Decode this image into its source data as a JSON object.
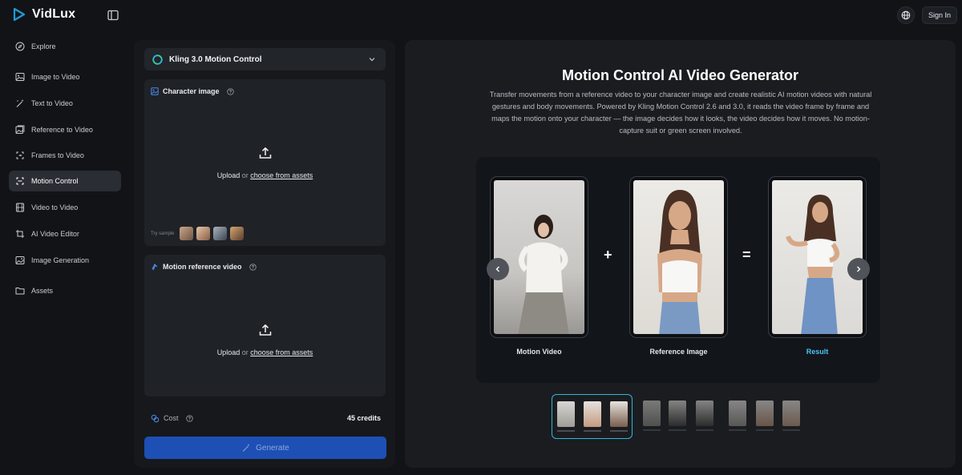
{
  "app": {
    "name": "VidLux",
    "brand_color": "#1e9bd7",
    "accent_color": "#31b7d8"
  },
  "header": {
    "sign_in_label": "Sign In",
    "language_icon": "globe-icon",
    "sidebar_toggle_icon": "sidebar-toggle-icon"
  },
  "sidebar": {
    "items": [
      {
        "label": "Explore",
        "icon": "compass-icon"
      },
      {
        "label": "Image to Video",
        "icon": "image-icon"
      },
      {
        "label": "Text to Video",
        "icon": "magic-wand-icon"
      },
      {
        "label": "Reference to Video",
        "icon": "image-stack-icon"
      },
      {
        "label": "Frames to Video",
        "icon": "frames-icon"
      },
      {
        "label": "Motion Control",
        "icon": "motion-icon",
        "active": true
      },
      {
        "label": "Video to Video",
        "icon": "film-icon"
      },
      {
        "label": "AI Video Editor",
        "icon": "crop-icon"
      },
      {
        "label": "Image Generation",
        "icon": "image-sparkle-icon"
      },
      {
        "label": "Assets",
        "icon": "folder-icon"
      }
    ]
  },
  "form": {
    "model": {
      "selected": "Kling 3.0 Motion Control"
    },
    "character": {
      "title": "Character image",
      "upload": "Upload",
      "or": "or",
      "choose": "choose from assets",
      "try_label": "Try sample"
    },
    "motion": {
      "title": "Motion reference video",
      "upload": "Upload",
      "or": "or",
      "choose": "choose from assets"
    },
    "cost": {
      "label": "Cost",
      "value": "45 credits"
    },
    "generate_label": "Generate"
  },
  "hero": {
    "title": "Motion Control AI Video Generator",
    "description": "Transfer movements from a reference video to your character image and create realistic AI motion videos with natural gestures and body movements. Powered by Kling Motion Control 2.6 and 3.0, it reads the video frame by frame and maps the motion onto your character — the image decides how it looks, the video decides how it moves. No motion-capture suit or green screen involved.",
    "demo": {
      "labels": [
        "Motion Video",
        "Reference Image",
        "Result"
      ],
      "plus": "+",
      "equals": "="
    }
  }
}
